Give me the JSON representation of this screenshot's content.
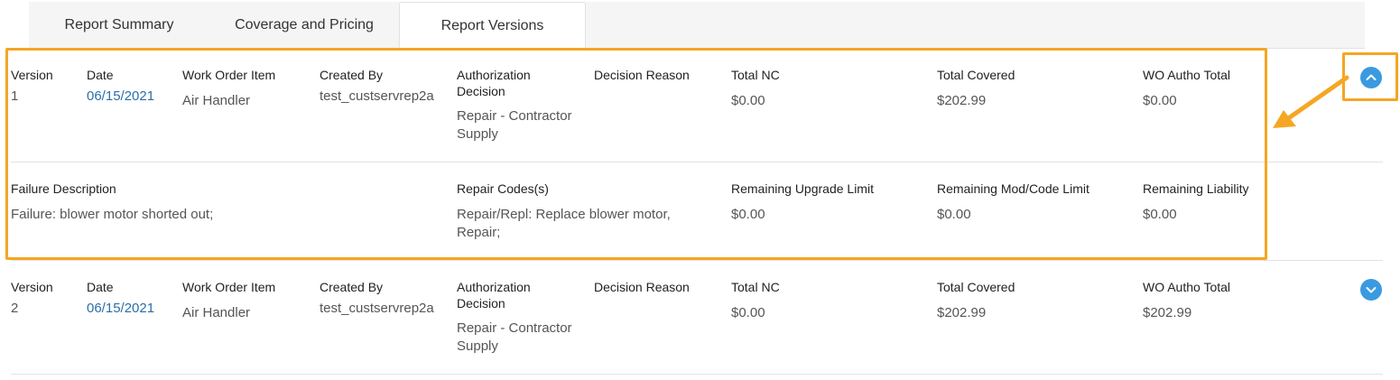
{
  "tabs": [
    {
      "label": "Report Summary",
      "active": false
    },
    {
      "label": "Coverage and Pricing",
      "active": false
    },
    {
      "label": "Report Versions",
      "active": true
    }
  ],
  "labels": {
    "version": "Version",
    "date": "Date",
    "work_order_item": "Work Order Item",
    "created_by": "Created By",
    "authorization_decision": "Authorization Decision",
    "decision_reason": "Decision Reason",
    "total_nc": "Total NC",
    "total_covered": "Total Covered",
    "wo_autho_total": "WO Autho Total",
    "failure_description": "Failure Description",
    "repair_codes": "Repair Codes(s)",
    "remaining_upgrade_limit": "Remaining Upgrade Limit",
    "remaining_mod_code_limit": "Remaining Mod/Code Limit",
    "remaining_liability": "Remaining Liability"
  },
  "versions": [
    {
      "version": "1",
      "date": "06/15/2021",
      "work_order_item": "Air Handler",
      "created_by": "test_custservrep2a",
      "authorization_decision": "Repair - Contractor Supply",
      "decision_reason": "",
      "total_nc": "$0.00",
      "total_covered": "$202.99",
      "wo_autho_total": "$0.00",
      "expanded": true,
      "failure_description": "Failure: blower motor shorted out;",
      "repair_codes": "Repair/Repl: Replace blower motor, Repair;",
      "remaining_upgrade_limit": "$0.00",
      "remaining_mod_code_limit": "$0.00",
      "remaining_liability": "$0.00"
    },
    {
      "version": "2",
      "date": "06/15/2021",
      "work_order_item": "Air Handler",
      "created_by": "test_custservrep2a",
      "authorization_decision": "Repair - Contractor Supply",
      "decision_reason": "",
      "total_nc": "$0.00",
      "total_covered": "$202.99",
      "wo_autho_total": "$202.99",
      "expanded": false
    }
  ],
  "colors": {
    "accent": "#3a9ae0",
    "highlight": "#f5a623",
    "link": "#2a6fa8"
  },
  "icons": {
    "collapse": "chevron-up-icon",
    "expand": "chevron-down-icon"
  }
}
